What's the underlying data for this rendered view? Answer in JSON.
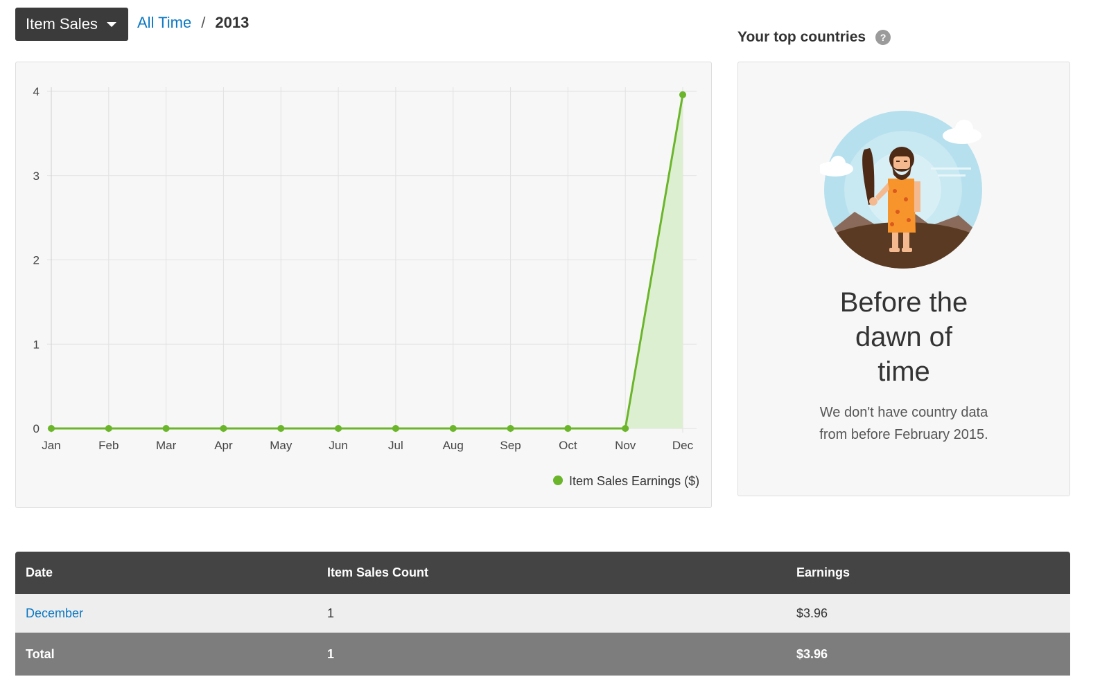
{
  "toolbar": {
    "dropdown_label": "Item Sales",
    "breadcrumb": {
      "link": "All Time",
      "separator": "/",
      "current": "2013"
    }
  },
  "chart_data": {
    "type": "area",
    "categories": [
      "Jan",
      "Feb",
      "Mar",
      "Apr",
      "May",
      "Jun",
      "Jul",
      "Aug",
      "Sep",
      "Oct",
      "Nov",
      "Dec"
    ],
    "series": [
      {
        "name": "Item Sales Earnings ($)",
        "values": [
          0,
          0,
          0,
          0,
          0,
          0,
          0,
          0,
          0,
          0,
          0,
          3.96
        ],
        "color": "#6bb52a"
      }
    ],
    "yticks": [
      "0",
      "1",
      "2",
      "3",
      "4"
    ],
    "ylim": [
      0,
      4
    ],
    "grid": true,
    "legend_position": "bottom-right"
  },
  "countries": {
    "title": "Your top countries",
    "help_icon": "?",
    "empty_heading_lines": [
      "Before the",
      "dawn of",
      "time"
    ],
    "empty_text_lines": [
      "We don't have country data",
      "from before February 2015."
    ]
  },
  "table": {
    "headers": [
      "Date",
      "Item Sales Count",
      "Earnings"
    ],
    "rows": [
      {
        "date": "December",
        "count": "1",
        "earnings": "$3.96"
      }
    ],
    "total": {
      "label": "Total",
      "count": "1",
      "earnings": "$3.96"
    }
  }
}
